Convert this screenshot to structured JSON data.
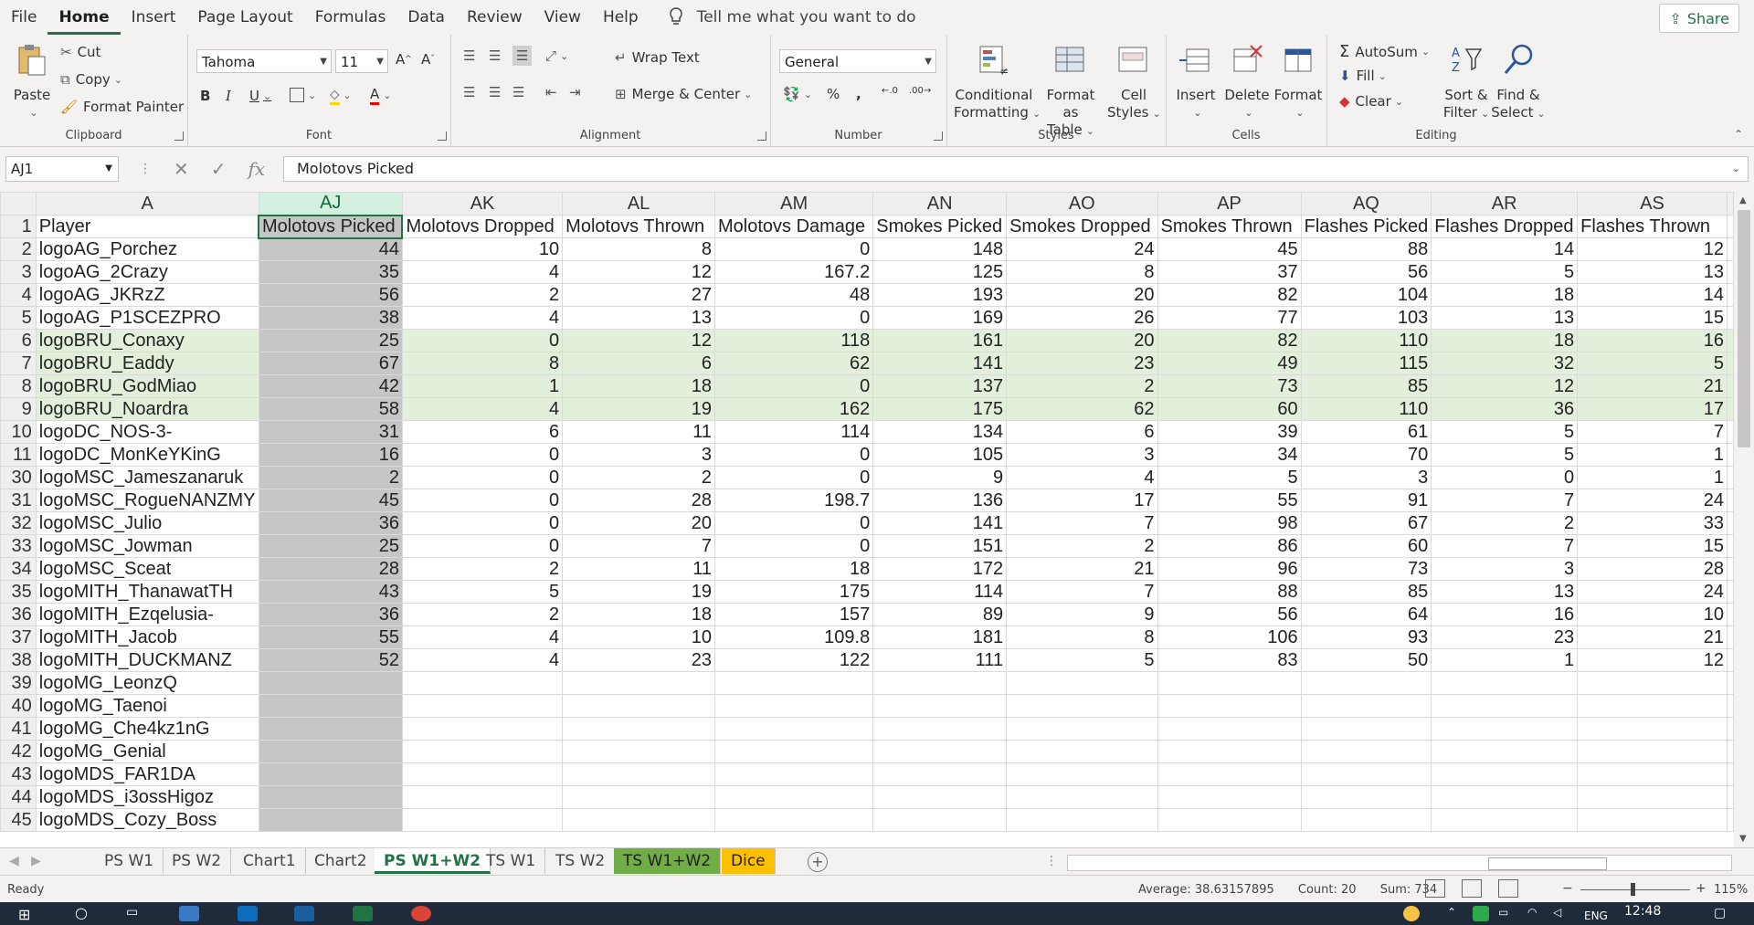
{
  "menu": {
    "items": [
      "File",
      "Home",
      "Insert",
      "Page Layout",
      "Formulas",
      "Data",
      "Review",
      "View",
      "Help"
    ],
    "active": "Home",
    "tell_me": "Tell me what you want to do",
    "share": "Share"
  },
  "ribbon": {
    "clipboard": {
      "label": "Clipboard",
      "paste": "Paste",
      "cut": "Cut",
      "copy": "Copy",
      "format_painter": "Format Painter"
    },
    "font": {
      "label": "Font",
      "name": "Tahoma",
      "size": "11"
    },
    "alignment": {
      "label": "Alignment",
      "wrap_text": "Wrap Text",
      "merge_center": "Merge & Center"
    },
    "number": {
      "label": "Number",
      "format": "General",
      "percent": "%",
      "comma": ","
    },
    "styles": {
      "label": "Styles",
      "conditional_1": "Conditional",
      "conditional_2": "Formatting",
      "format_table_1": "Format as",
      "format_table_2": "Table",
      "cell_styles_1": "Cell",
      "cell_styles_2": "Styles"
    },
    "cells": {
      "label": "Cells",
      "insert": "Insert",
      "delete": "Delete",
      "format": "Format"
    },
    "editing": {
      "label": "Editing",
      "autosum": "AutoSum",
      "fill": "Fill",
      "clear": "Clear",
      "sort_1": "Sort &",
      "sort_2": "Filter",
      "find_1": "Find &",
      "find_2": "Select"
    }
  },
  "formula_bar": {
    "name_box": "AJ1",
    "fx": "fx",
    "content": "Molotovs Picked"
  },
  "grid": {
    "columns": [
      "A",
      "AJ",
      "AK",
      "AL",
      "AM",
      "AN",
      "AO",
      "AP",
      "AQ",
      "AR",
      "AS"
    ],
    "header_row": [
      "Player",
      "Molotovs Picked",
      "Molotovs Dropped",
      "Molotovs Thrown",
      "Molotovs Damage",
      "Smokes Picked",
      "Smokes Dropped",
      "Smokes Thrown",
      "Flashes Picked",
      "Flashes Dropped",
      "Flashes Thrown"
    ],
    "rows": [
      {
        "n": "2",
        "hl": false,
        "cells": [
          "logoAG_Porchez",
          "44",
          "10",
          "8",
          "0",
          "148",
          "24",
          "45",
          "88",
          "14",
          "12"
        ]
      },
      {
        "n": "3",
        "hl": false,
        "cells": [
          "logoAG_2Crazy",
          "35",
          "4",
          "12",
          "167.2",
          "125",
          "8",
          "37",
          "56",
          "5",
          "13"
        ]
      },
      {
        "n": "4",
        "hl": false,
        "cells": [
          "logoAG_JKRzZ",
          "56",
          "2",
          "27",
          "48",
          "193",
          "20",
          "82",
          "104",
          "18",
          "14"
        ]
      },
      {
        "n": "5",
        "hl": false,
        "cells": [
          "logoAG_P1SCEZPRO",
          "38",
          "4",
          "13",
          "0",
          "169",
          "26",
          "77",
          "103",
          "13",
          "15"
        ]
      },
      {
        "n": "6",
        "hl": true,
        "cells": [
          "logoBRU_Conaxy",
          "25",
          "0",
          "12",
          "118",
          "161",
          "20",
          "82",
          "110",
          "18",
          "16"
        ]
      },
      {
        "n": "7",
        "hl": true,
        "cells": [
          "logoBRU_Eaddy",
          "67",
          "8",
          "6",
          "62",
          "141",
          "23",
          "49",
          "115",
          "32",
          "5"
        ]
      },
      {
        "n": "8",
        "hl": true,
        "cells": [
          "logoBRU_GodMiao",
          "42",
          "1",
          "18",
          "0",
          "137",
          "2",
          "73",
          "85",
          "12",
          "21"
        ]
      },
      {
        "n": "9",
        "hl": true,
        "cells": [
          "logoBRU_Noardra",
          "58",
          "4",
          "19",
          "162",
          "175",
          "62",
          "60",
          "110",
          "36",
          "17"
        ]
      },
      {
        "n": "10",
        "hl": false,
        "cells": [
          "logoDC_NOS-3-",
          "31",
          "6",
          "11",
          "114",
          "134",
          "6",
          "39",
          "61",
          "5",
          "7"
        ]
      },
      {
        "n": "11",
        "hl": false,
        "cells": [
          "logoDC_MonKeYKinG",
          "16",
          "0",
          "3",
          "0",
          "105",
          "3",
          "34",
          "70",
          "5",
          "1"
        ]
      },
      {
        "n": "30",
        "hl": false,
        "cells": [
          "logoMSC_Jameszanaruk",
          "2",
          "0",
          "2",
          "0",
          "9",
          "4",
          "5",
          "3",
          "0",
          "1"
        ]
      },
      {
        "n": "31",
        "hl": false,
        "cells": [
          "logoMSC_RogueNANZMY",
          "45",
          "0",
          "28",
          "198.7",
          "136",
          "17",
          "55",
          "91",
          "7",
          "24"
        ]
      },
      {
        "n": "32",
        "hl": false,
        "cells": [
          "logoMSC_Julio",
          "36",
          "0",
          "20",
          "0",
          "141",
          "7",
          "98",
          "67",
          "2",
          "33"
        ]
      },
      {
        "n": "33",
        "hl": false,
        "cells": [
          "logoMSC_Jowman",
          "25",
          "0",
          "7",
          "0",
          "151",
          "2",
          "86",
          "60",
          "7",
          "15"
        ]
      },
      {
        "n": "34",
        "hl": false,
        "cells": [
          "logoMSC_Sceat",
          "28",
          "2",
          "11",
          "18",
          "172",
          "21",
          "96",
          "73",
          "3",
          "28"
        ]
      },
      {
        "n": "35",
        "hl": false,
        "cells": [
          "logoMITH_ThanawatTH",
          "43",
          "5",
          "19",
          "175",
          "114",
          "7",
          "88",
          "85",
          "13",
          "24"
        ]
      },
      {
        "n": "36",
        "hl": false,
        "cells": [
          "logoMITH_Ezqelusia-",
          "36",
          "2",
          "18",
          "157",
          "89",
          "9",
          "56",
          "64",
          "16",
          "10"
        ]
      },
      {
        "n": "37",
        "hl": false,
        "cells": [
          "logoMITH_Jacob",
          "55",
          "4",
          "10",
          "109.8",
          "181",
          "8",
          "106",
          "93",
          "23",
          "21"
        ]
      },
      {
        "n": "38",
        "hl": false,
        "cells": [
          "logoMITH_DUCKMANZ",
          "52",
          "4",
          "23",
          "122",
          "111",
          "5",
          "83",
          "50",
          "1",
          "12"
        ]
      },
      {
        "n": "39",
        "hl": false,
        "cells": [
          "logoMG_LeonzQ",
          "",
          "",
          "",
          "",
          "",
          "",
          "",
          "",
          "",
          ""
        ]
      },
      {
        "n": "40",
        "hl": false,
        "cells": [
          "logoMG_Taenoi",
          "",
          "",
          "",
          "",
          "",
          "",
          "",
          "",
          "",
          ""
        ]
      },
      {
        "n": "41",
        "hl": false,
        "cells": [
          "logoMG_Che4kz1nG",
          "",
          "",
          "",
          "",
          "",
          "",
          "",
          "",
          "",
          ""
        ]
      },
      {
        "n": "42",
        "hl": false,
        "cells": [
          "logoMG_Genial",
          "",
          "",
          "",
          "",
          "",
          "",
          "",
          "",
          "",
          ""
        ]
      },
      {
        "n": "43",
        "hl": false,
        "cells": [
          "logoMDS_FAR1DA",
          "",
          "",
          "",
          "",
          "",
          "",
          "",
          "",
          "",
          ""
        ]
      },
      {
        "n": "44",
        "hl": false,
        "cells": [
          "logoMDS_i3ossHigoz",
          "",
          "",
          "",
          "",
          "",
          "",
          "",
          "",
          "",
          ""
        ]
      },
      {
        "n": "45",
        "hl": false,
        "cells": [
          "logoMDS_Cozy_Boss",
          "",
          "",
          "",
          "",
          "",
          "",
          "",
          "",
          "",
          ""
        ]
      }
    ]
  },
  "sheet_tabs": [
    {
      "name": "PS W1",
      "style": ""
    },
    {
      "name": "PS W2",
      "style": ""
    },
    {
      "name": "Chart1",
      "style": ""
    },
    {
      "name": "Chart2",
      "style": ""
    },
    {
      "name": "PS W1+W2",
      "style": "active"
    },
    {
      "name": "TS W1",
      "style": ""
    },
    {
      "name": "TS W2",
      "style": ""
    },
    {
      "name": "TS W1+W2",
      "style": "green"
    },
    {
      "name": "Dice",
      "style": "orange"
    }
  ],
  "status": {
    "ready": "Ready",
    "average": "Average: 38.63157895",
    "count": "Count: 20",
    "sum": "Sum: 734",
    "zoom": "115%"
  },
  "taskbar": {
    "lang": "ENG",
    "time": "12:48"
  },
  "colors": {
    "accent": "#217346",
    "highlight_row": "#e2efda",
    "selected_col": "#c6c6c6",
    "tab_green": "#70ad47",
    "tab_orange": "#ffc000"
  }
}
